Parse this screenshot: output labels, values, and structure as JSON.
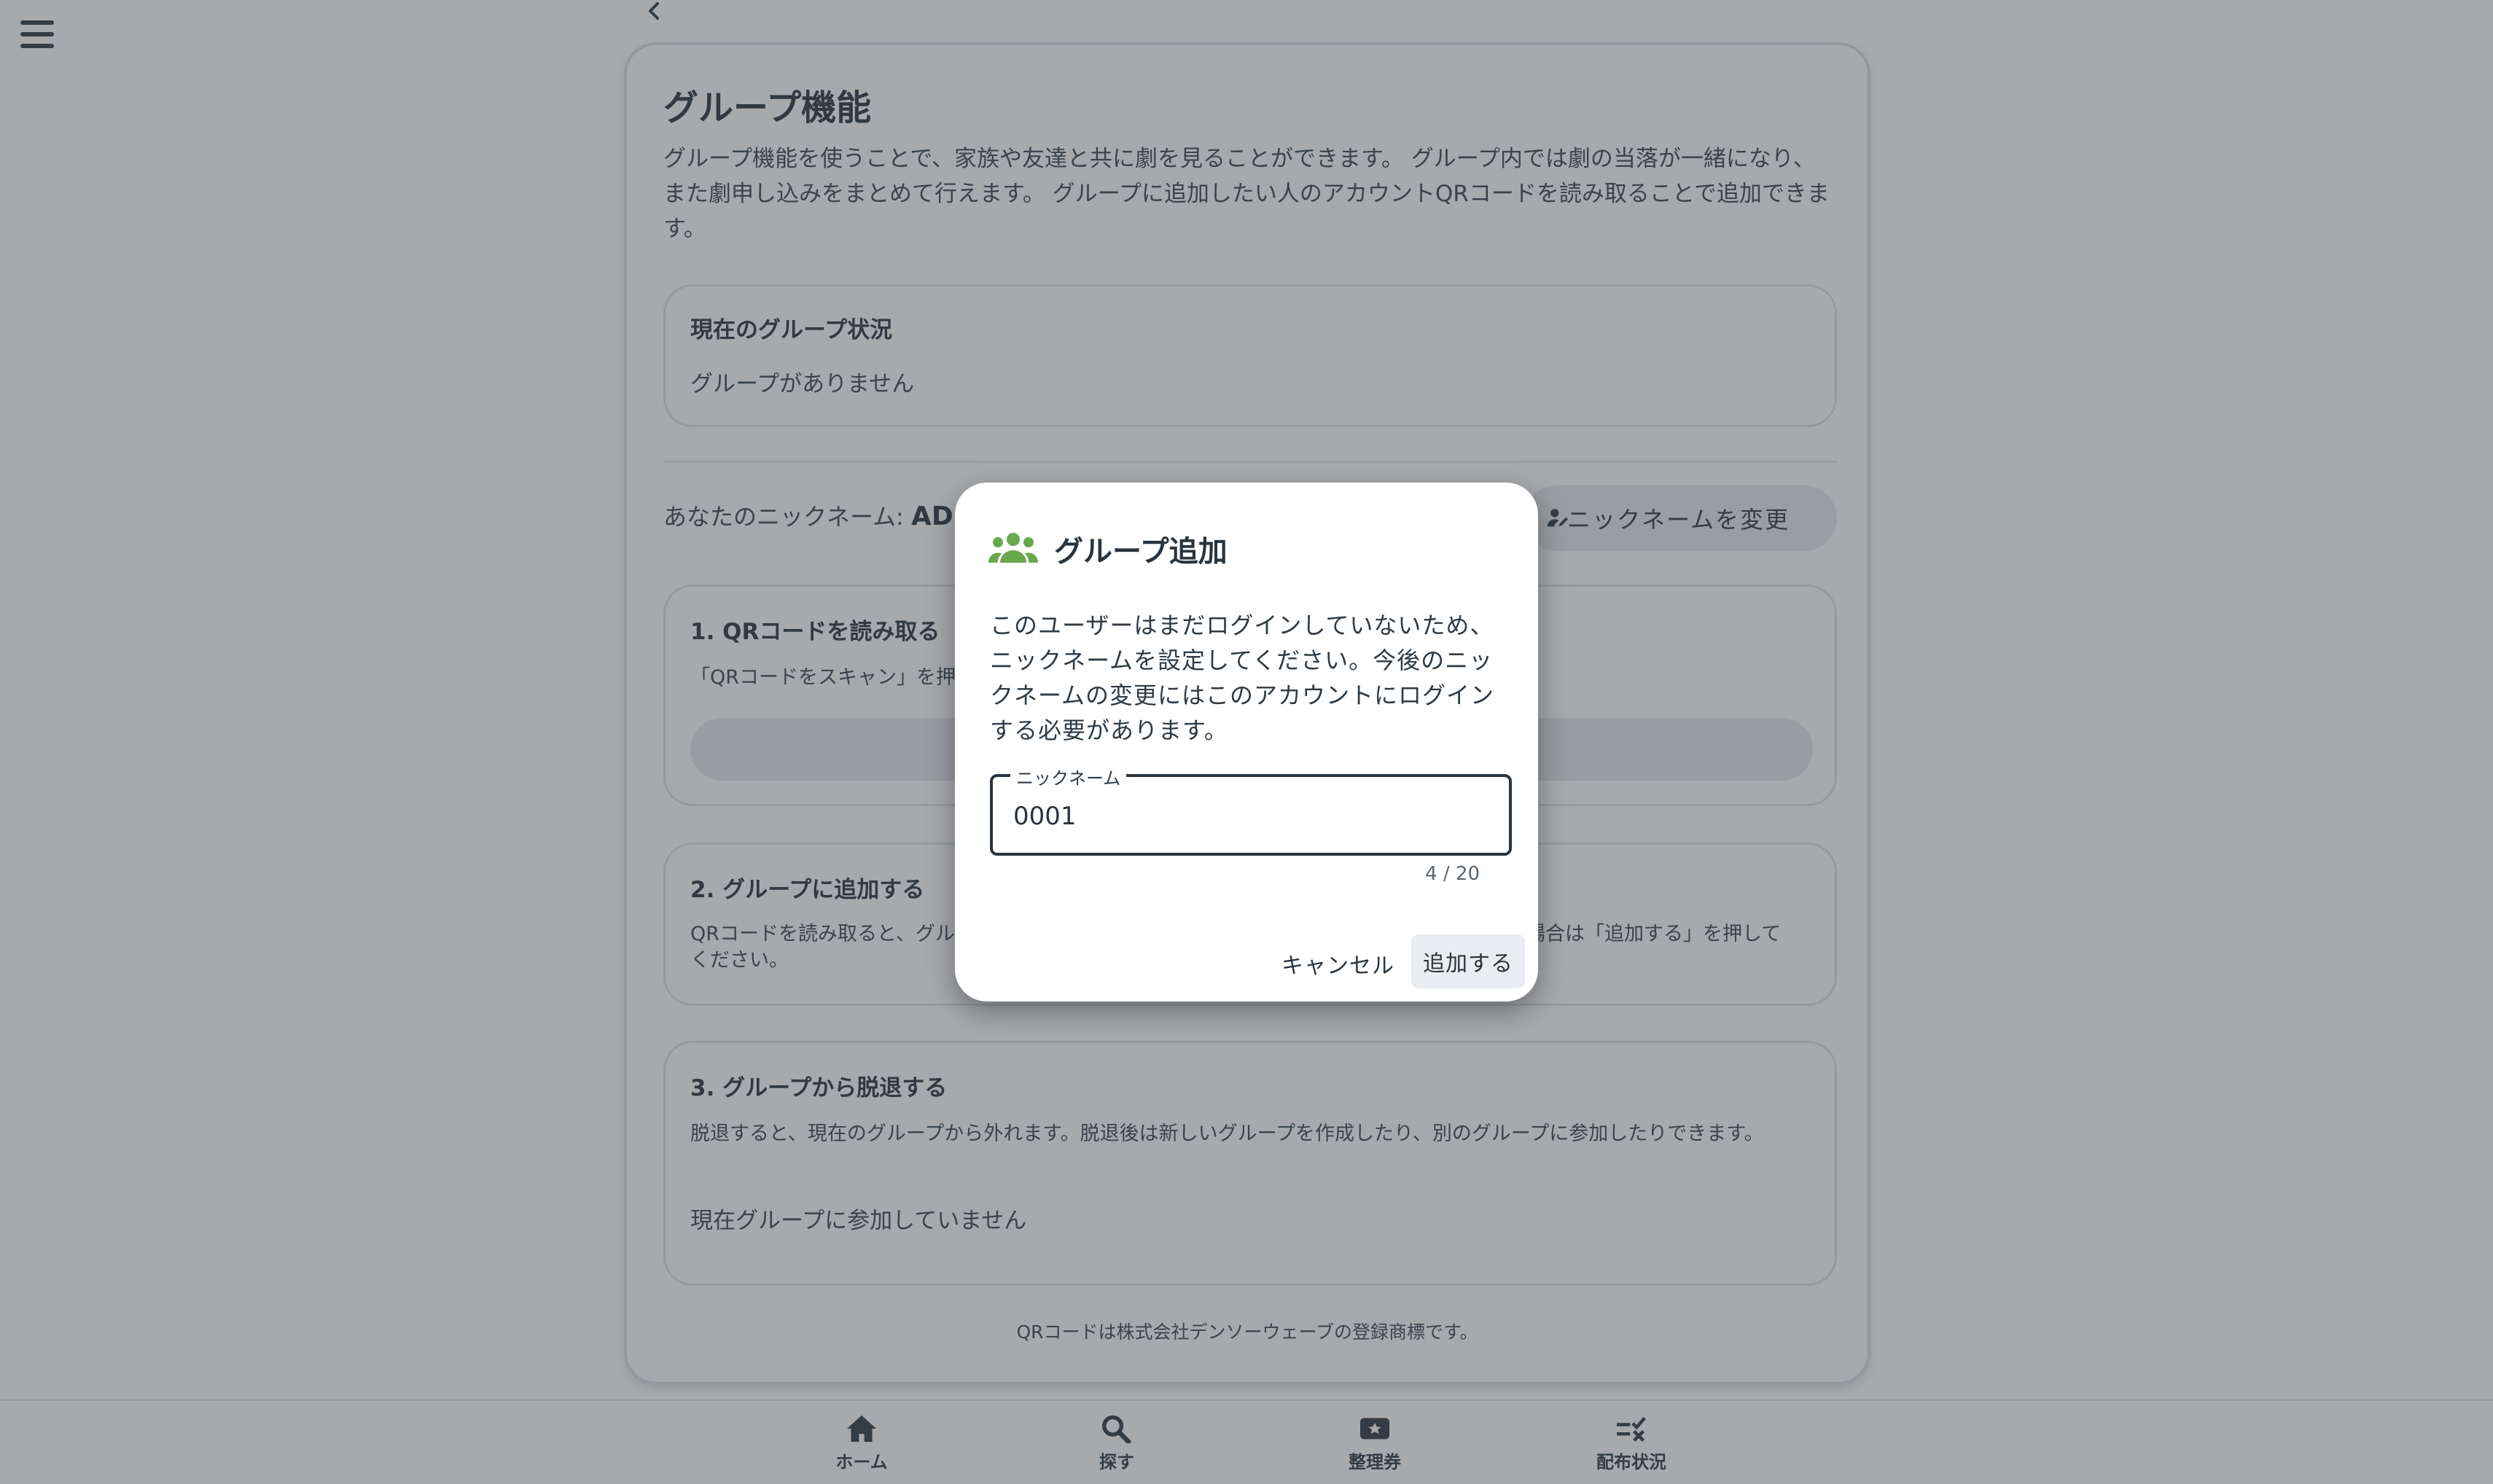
{
  "back_icon": "chevron-left-icon",
  "menu_icon": "hamburger-menu-icon",
  "card": {
    "title": "グループ機能",
    "description": "グループ機能を使うことで、家族や友達と共に劇を見ることができます。 グループ内では劇の当落が一緒になり、また劇申し込みをまとめて行えます。 グループに追加したい人のアカウントQRコードを読み取ることで追加できます。"
  },
  "status": {
    "title": "現在のグループ状況",
    "text": "グループがありません"
  },
  "nickname": {
    "label": "あなたのニックネーム:",
    "value": "AD",
    "change_button": "ニックネームを変更"
  },
  "step1": {
    "title": "1. QRコードを読み取る",
    "text": "「QRコードをスキャン」を押"
  },
  "step2": {
    "title": "2. グループに追加する",
    "text_left": "QRコードを読み取ると、グル",
    "text_right": "場合は「追加する」を押して",
    "text_line2": "ください。"
  },
  "step3": {
    "title": "3. グループから脱退する",
    "text": "脱退すると、現在のグループから外れます。脱退後は新しいグループを作成したり、別のグループに参加したりできます。",
    "status": "現在グループに参加していません"
  },
  "footer_note": "QRコードは株式会社デンソーウェーブの登録商標です。",
  "bottom_nav": [
    {
      "label": "ホーム",
      "icon": "home-icon"
    },
    {
      "label": "探す",
      "icon": "search-icon"
    },
    {
      "label": "整理券",
      "icon": "ticket-icon"
    },
    {
      "label": "配布状況",
      "icon": "checklist-icon"
    }
  ],
  "dialog": {
    "title": "グループ追加",
    "icon": "group-icon",
    "icon_color": "#6aa84f",
    "body": "このユーザーはまだログインしていないため、ニックネームを設定してください。今後のニックネームの変更にはこのアカウントにログインする必要があります。",
    "field_label": "ニックネーム",
    "field_value": "0001",
    "counter": "4 / 20",
    "cancel": "キャンセル",
    "add": "追加する"
  }
}
